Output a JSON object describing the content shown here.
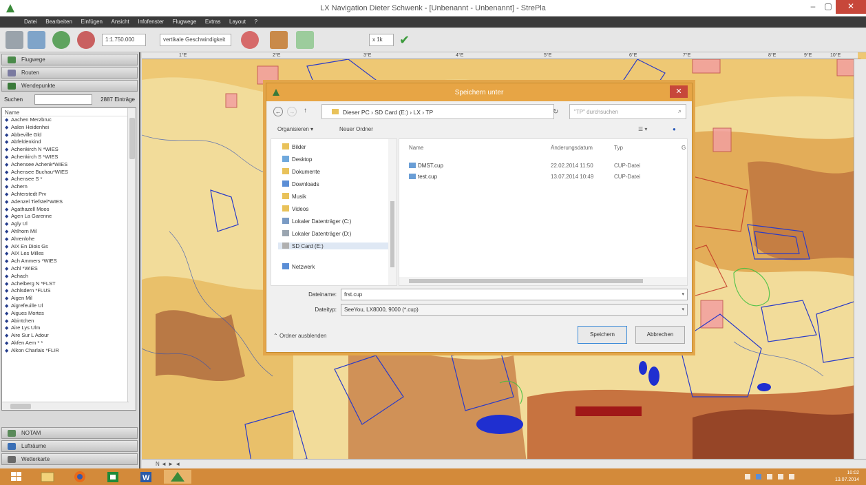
{
  "window": {
    "title": "LX Navigation Dieter Schwenk - [Unbenannt - Unbenannt] - StrePla",
    "min": "–",
    "max": "▢",
    "close": "✕"
  },
  "menu": [
    "Datei",
    "Bearbeiten",
    "Einfügen",
    "Ansicht",
    "Infofenster",
    "Flugwege",
    "Extras",
    "Layout",
    "?"
  ],
  "toolbar": {
    "scale": "1:1.750.000",
    "mode": "vertikale Geschwindigkeit",
    "zoom": "x 1k"
  },
  "sidebar": {
    "flugwege": "Flugwege",
    "routen": "Routen",
    "wendepunkte": "Wendepunkte",
    "search_label": "Suchen",
    "search_value": "",
    "count": "2887 Einträge",
    "column_header": "Name",
    "items": [
      "Aachen Merzbruc",
      "Aalen Heidenhei",
      "Abbeville Gld",
      "Abfeldenkind",
      "Achenkirch N  *WIES",
      "Achenkirch S  *WIES",
      "Achensee Achenk*WIES",
      "Achensee Buchau*WIES",
      "Achensee S  *",
      "Achern",
      "Achterstedt Prv",
      "Adenzel Tiefstel*WIES",
      "Agathazell Moos",
      "Agen La Garenne",
      "Agly Ul",
      "Ahlhorn Mil",
      "Ahrenlohe",
      "AIX En Diois Gs",
      "AIX Les Milles",
      "Ach Ammers  *WIES",
      "Achl         *WIES",
      "Achach",
      "Achelberg N  *FLST",
      "Achlsdern   *FLUS",
      "Aigen Mil",
      "Aigrefeuille Ul",
      "Aigues Mortes",
      "Abintchen",
      "Aire Lys Ulm",
      "Aire Sur L Adour",
      "Akfen Aem   *  *",
      "Alkon Charlais  *FLIR"
    ],
    "notam": "NOTAM",
    "luftraume": "Lufträume",
    "wetterkarte": "Wetterkarte"
  },
  "ruler": [
    "1°E",
    "2°E",
    "3°E",
    "4°E",
    "5°E",
    "6°E",
    "7°E",
    "8°E",
    "9°E",
    "10°E"
  ],
  "map_bottom": "N ◄ ► ◄",
  "dialog": {
    "title": "Speichern unter",
    "breadcrumb": "Dieser PC  ›  SD Card (E:)  ›  LX  ›  TP",
    "search_placeholder": "\"TP\" durchsuchen",
    "organize": "Organisieren ▾",
    "new_folder": "Neuer Ordner",
    "nav_items": [
      {
        "label": "Bilder",
        "color": "#e9c25a"
      },
      {
        "label": "Desktop",
        "color": "#6fa8dc"
      },
      {
        "label": "Dokumente",
        "color": "#e9c25a"
      },
      {
        "label": "Downloads",
        "color": "#5b8ed6"
      },
      {
        "label": "Musik",
        "color": "#e9c25a"
      },
      {
        "label": "Videos",
        "color": "#e9c25a"
      },
      {
        "label": "Lokaler Datenträger (C:)",
        "color": "#7a9bc4"
      },
      {
        "label": "Lokaler Datenträger (D:)",
        "color": "#9aa5b0"
      },
      {
        "label": "SD Card (E:)",
        "color": "#b0b0b0"
      },
      {
        "label": "Netzwerk",
        "color": "#5b8ed6"
      }
    ],
    "columns": {
      "name": "Name",
      "date": "Änderungsdatum",
      "type": "Typ",
      "size": "G"
    },
    "files": [
      {
        "name": "DMST.cup",
        "date": "22.02.2014 11:50",
        "type": "CUP-Datei"
      },
      {
        "name": "test.cup",
        "date": "13.07.2014 10:49",
        "type": "CUP-Datei"
      }
    ],
    "filename_label": "Dateiname:",
    "filename_value": "frst.cup",
    "filetype_label": "Dateityp:",
    "filetype_value": "SeeYou, LX8000, 9000 (*.cup)",
    "hide_folders": "Ordner ausblenden",
    "save": "Speichern",
    "cancel": "Abbrechen"
  },
  "taskbar": {
    "time": "10:02",
    "date": "13.07.2014"
  },
  "colors": {
    "dialog_accent": "#e7a545",
    "taskbar": "#d38a3a",
    "close_red": "#c7473a",
    "airspace_blue": "#1f2fb8"
  }
}
